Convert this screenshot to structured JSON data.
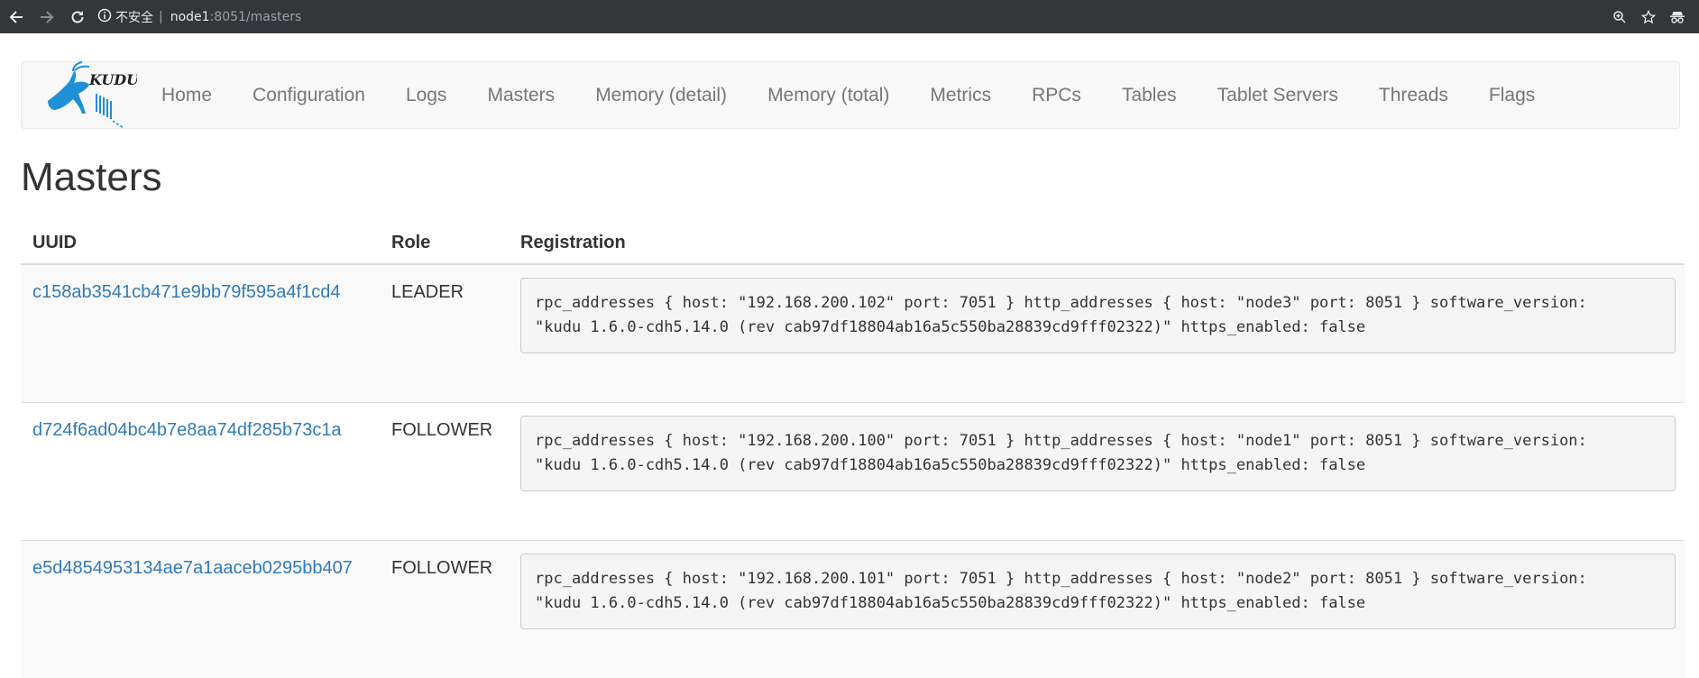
{
  "browser": {
    "security_label": "不安全",
    "host": "node1",
    "path": ":8051/masters"
  },
  "nav": {
    "brand_text": "KUDU",
    "links": [
      "Home",
      "Configuration",
      "Logs",
      "Masters",
      "Memory (detail)",
      "Memory (total)",
      "Metrics",
      "RPCs",
      "Tables",
      "Tablet Servers",
      "Threads",
      "Flags"
    ]
  },
  "page": {
    "title": "Masters"
  },
  "table": {
    "headers": [
      "UUID",
      "Role",
      "Registration"
    ],
    "rows": [
      {
        "uuid": "c158ab3541cb471e9bb79f595a4f1cd4",
        "role": "LEADER",
        "registration": "rpc_addresses { host: \"192.168.200.102\" port: 7051 } http_addresses { host: \"node3\" port: 8051 } software_version:\n\"kudu 1.6.0-cdh5.14.0 (rev cab97df18804ab16a5c550ba28839cd9fff02322)\" https_enabled: false"
      },
      {
        "uuid": "d724f6ad04bc4b7e8aa74df285b73c1a",
        "role": "FOLLOWER",
        "registration": "rpc_addresses { host: \"192.168.200.100\" port: 7051 } http_addresses { host: \"node1\" port: 8051 } software_version:\n\"kudu 1.6.0-cdh5.14.0 (rev cab97df18804ab16a5c550ba28839cd9fff02322)\" https_enabled: false"
      },
      {
        "uuid": "e5d4854953134ae7a1aaceb0295bb407",
        "role": "FOLLOWER",
        "registration": "rpc_addresses { host: \"192.168.200.101\" port: 7051 } http_addresses { host: \"node2\" port: 8051 } software_version:\n\"kudu 1.6.0-cdh5.14.0 (rev cab97df18804ab16a5c550ba28839cd9fff02322)\" https_enabled: false"
      }
    ]
  },
  "colors": {
    "link": "#337ab7",
    "chrome_bg": "#35363a",
    "navbar_bg": "#f8f8f8",
    "logo": "#1e90d6"
  }
}
